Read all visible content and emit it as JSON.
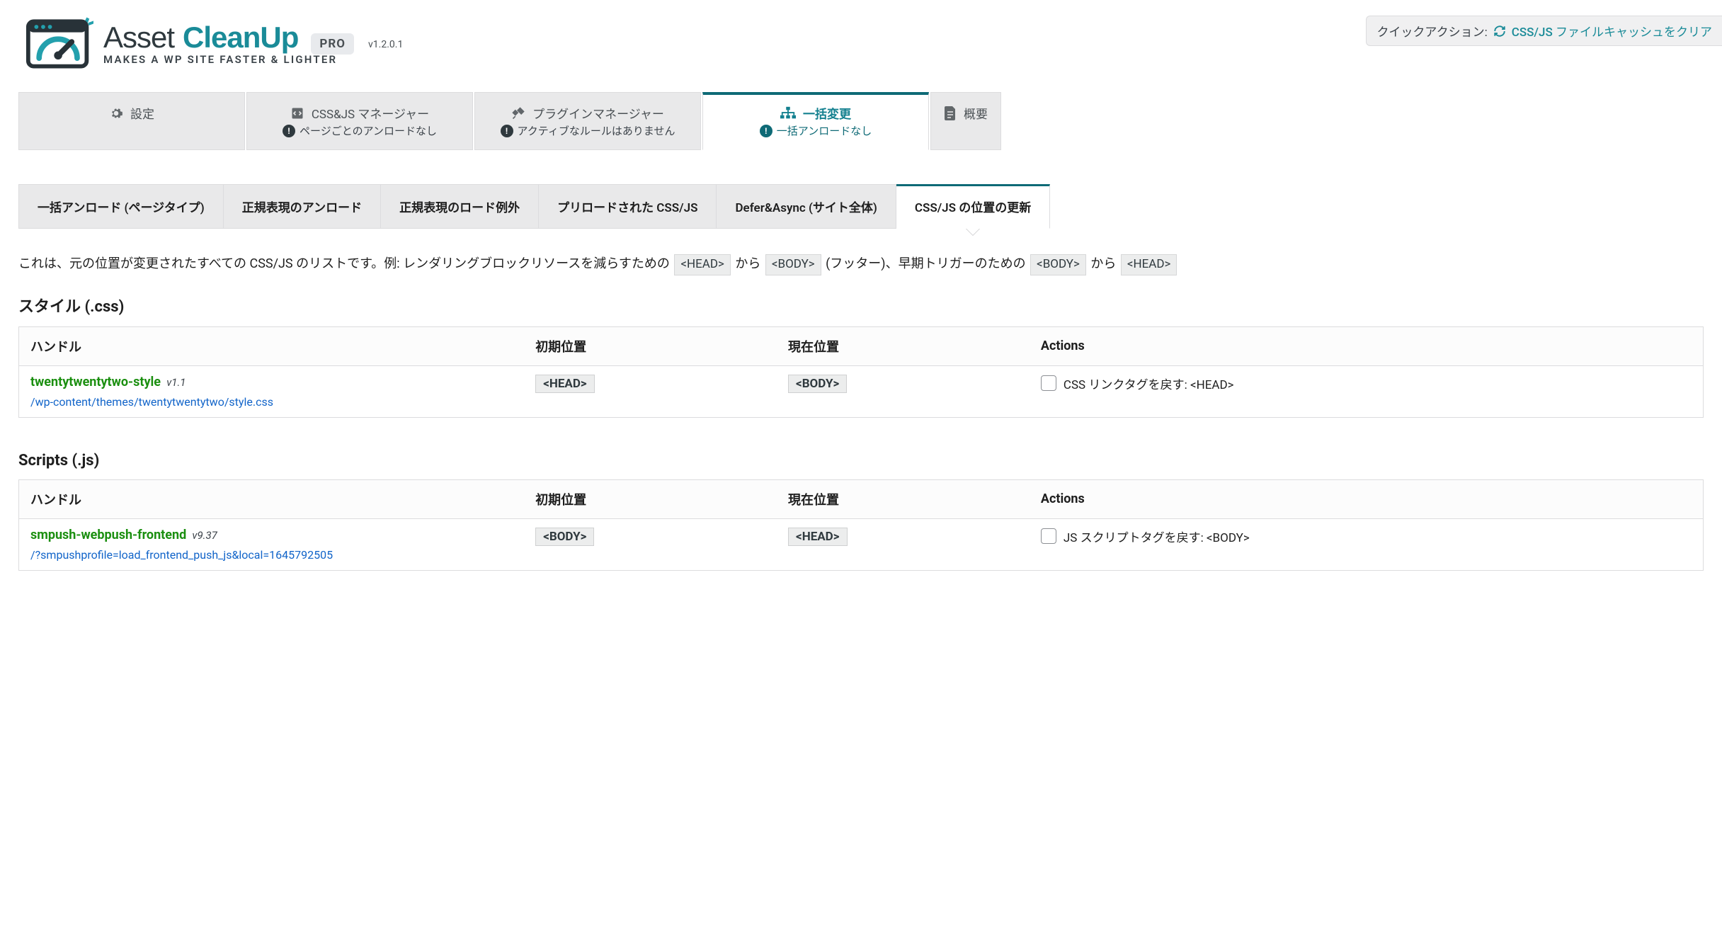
{
  "brand": {
    "asset": "Asset",
    "cleanup": "CleanUp",
    "pro": "PRO",
    "tagline": "MAKES A WP SITE FASTER & LIGHTER",
    "version": "v1.2.0.1"
  },
  "quick_actions": {
    "label": "クイックアクション:",
    "link": "CSS/JS ファイルキャッシュをクリア"
  },
  "main_tabs": {
    "settings": {
      "label": "設定"
    },
    "cssjs": {
      "label": "CSS&JS マネージャー",
      "sub": "ページごとのアンロードなし"
    },
    "plugins": {
      "label": "プラグインマネージャー",
      "sub": "アクティブなルールはありません"
    },
    "bulk": {
      "label": "一括変更",
      "sub": "一括アンロードなし"
    },
    "overview": {
      "label": "概要"
    }
  },
  "sub_tabs": {
    "t1": "一括アンロード (ページタイプ)",
    "t2": "正規表現のアンロード",
    "t3": "正規表現のロード例外",
    "t4": "プリロードされた CSS/JS",
    "t5": "Defer&Async (サイト全体)",
    "t6": "CSS/JS の位置の更新"
  },
  "desc": {
    "part1": "これは、元の位置が変更されたすべての CSS/JS のリストです。例: レンダリングブロックリソースを減らすための",
    "head": "<HEAD>",
    "to1": "から",
    "body": "<BODY>",
    "footer": "(フッター)、早期トリガーのための",
    "to2": "から"
  },
  "styles_section": {
    "title": "スタイル (.css)",
    "th_handle": "ハンドル",
    "th_initial": "初期位置",
    "th_current": "現在位置",
    "th_actions": "Actions",
    "rows": [
      {
        "handle": "twentytwentytwo-style",
        "version": "v1.1",
        "path": "/wp-content/themes/twentytwentytwo/style.css",
        "initial": "<HEAD>",
        "current": "<BODY>",
        "action_label": "CSS リンクタグを戻す: <HEAD>"
      }
    ]
  },
  "scripts_section": {
    "title": "Scripts (.js)",
    "th_handle": "ハンドル",
    "th_initial": "初期位置",
    "th_current": "現在位置",
    "th_actions": "Actions",
    "rows": [
      {
        "handle": "smpush-webpush-frontend",
        "version": "v9.37",
        "path": "/?smpushprofile=load_frontend_push_js&local=1645792505",
        "initial": "<BODY>",
        "current": "<HEAD>",
        "action_label": "JS スクリプトタグを戻す: <BODY>"
      }
    ]
  }
}
